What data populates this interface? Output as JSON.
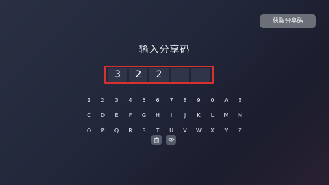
{
  "header": {
    "get_code_label": "获取分享码"
  },
  "main": {
    "title": "输入分享码",
    "code_slots": [
      "3",
      "2",
      "2",
      "",
      ""
    ]
  },
  "keyboard": {
    "rows": [
      [
        "1",
        "2",
        "3",
        "4",
        "5",
        "6",
        "7",
        "8",
        "9",
        "0",
        "A",
        "B"
      ],
      [
        "C",
        "D",
        "E",
        "F",
        "G",
        "H",
        "I",
        "J",
        "K",
        "L",
        "M",
        "N"
      ],
      [
        "O",
        "P",
        "Q",
        "R",
        "S",
        "T",
        "U",
        "V",
        "W",
        "X",
        "Y",
        "Z"
      ]
    ],
    "actions": [
      "trash-icon",
      "eye-icon"
    ]
  },
  "colors": {
    "highlight_border": "#d93030"
  }
}
